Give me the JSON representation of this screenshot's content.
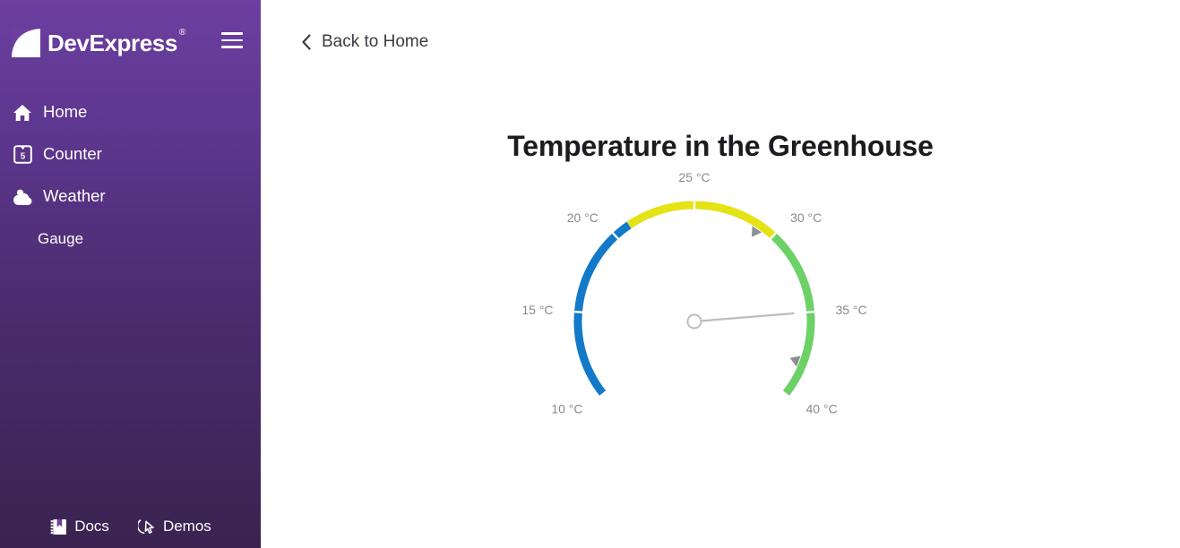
{
  "sidebar": {
    "brand": {
      "name": "DevExpress",
      "registered": "®",
      "logo_icon": "devexpress-logo-icon"
    },
    "menu_toggle_label": "Toggle navigation",
    "items": [
      {
        "label": "Home",
        "icon": "home-icon",
        "sub": false
      },
      {
        "label": "Counter",
        "icon": "counter-icon",
        "sub": false
      },
      {
        "label": "Weather",
        "icon": "weather-icon",
        "sub": false
      },
      {
        "label": "Gauge",
        "icon": "",
        "sub": true
      }
    ],
    "footer": [
      {
        "label": "Docs",
        "icon": "docs-icon"
      },
      {
        "label": "Demos",
        "icon": "demos-icon"
      }
    ],
    "colors": {
      "top": "#6c3fa0",
      "bottom": "#3a2350"
    }
  },
  "main": {
    "back_link": {
      "label": "Back to Home",
      "icon": "chevron-left-icon"
    },
    "title": "Temperature in the Greenhouse"
  },
  "chart_data": {
    "type": "gauge",
    "title": "Temperature in the Greenhouse",
    "unit": "°C",
    "scale": {
      "min": 10,
      "max": 40,
      "tick_interval": 5,
      "start_angle": 218,
      "end_angle": -38
    },
    "tick_labels": [
      "10 °C",
      "15 °C",
      "20 °C",
      "25 °C",
      "30 °C",
      "35 °C",
      "40 °C"
    ],
    "tick_values": [
      10,
      15,
      20,
      25,
      30,
      35,
      40
    ],
    "ranges": [
      {
        "start": 10,
        "end": 21,
        "color": "#1379c9",
        "name": "cold"
      },
      {
        "start": 21,
        "end": 30,
        "color": "#e5e216",
        "name": "optimal"
      },
      {
        "start": 30,
        "end": 40,
        "color": "#6ed167",
        "name": "hot"
      }
    ],
    "value": 35,
    "needle_color": "#bdbdbd",
    "markers": [
      {
        "value": 29,
        "color": "#8b8f96",
        "name": "marker-low"
      },
      {
        "value": 38,
        "color": "#8b8f96",
        "name": "marker-high"
      }
    ],
    "tick_color": "#ffffff",
    "label_color": "#8a8a8a"
  }
}
